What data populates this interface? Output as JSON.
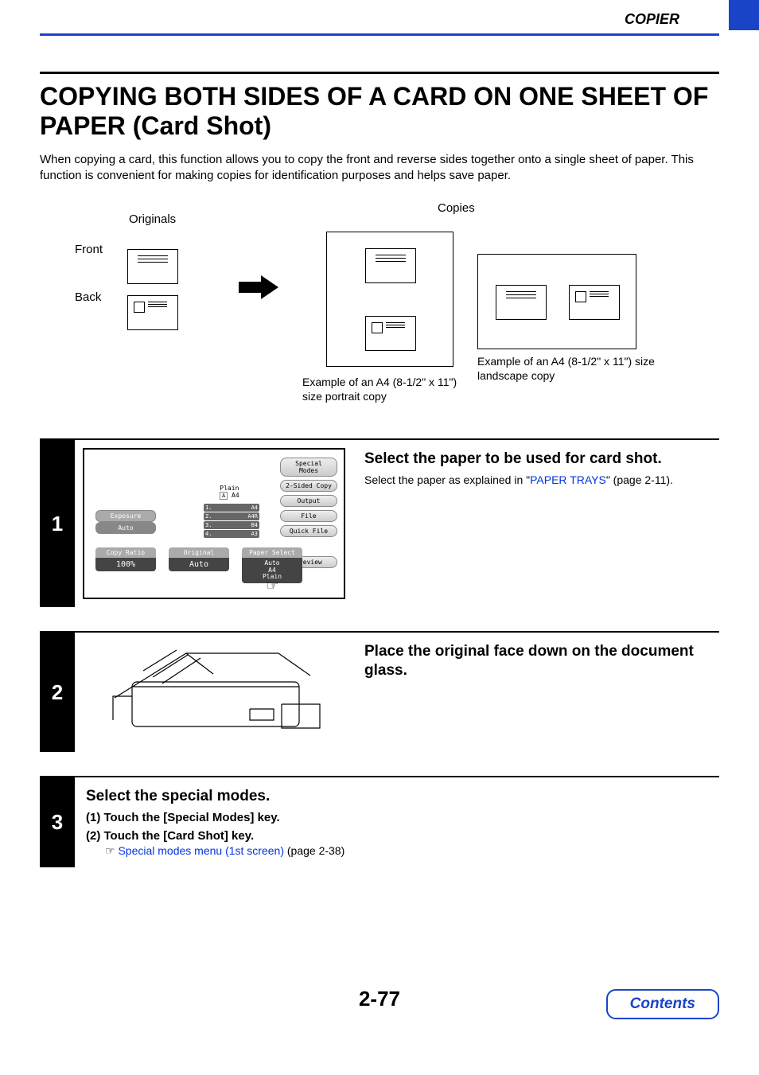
{
  "header": {
    "section": "COPIER"
  },
  "title": "COPYING BOTH SIDES OF A CARD ON ONE SHEET OF PAPER (Card Shot)",
  "intro": "When copying a card, this function allows you to copy the front and reverse sides together onto a single sheet of paper. This function is convenient for making copies for identification purposes and helps save paper.",
  "diagram": {
    "originals_label": "Originals",
    "front_label": "Front",
    "back_label": "Back",
    "copies_label": "Copies",
    "portrait_caption": "Example of an A4 (8-1/2\" x 11\") size portrait copy",
    "landscape_caption": "Example of an A4 (8-1/2\" x 11\") size landscape copy"
  },
  "ui_panel": {
    "special_modes": "Special Modes",
    "two_sided": "2-Sided Copy",
    "output": "Output",
    "file": "File",
    "quick_file": "Quick File",
    "preview": "Preview",
    "exposure_label": "Exposure",
    "exposure_value": "Auto",
    "copy_ratio_label": "Copy Ratio",
    "copy_ratio_value": "100%",
    "original_label": "Original",
    "original_value": "Auto",
    "paper_select_label": "Paper Select",
    "paper_select_value1": "Auto",
    "paper_select_value2": "A4",
    "paper_select_value3": "Plain",
    "plain_label": "Plain",
    "plain_size": "A4",
    "trays": [
      {
        "n": "1.",
        "s": "A4"
      },
      {
        "n": "2.",
        "s": "A4R"
      },
      {
        "n": "3.",
        "s": "B4"
      },
      {
        "n": "4.",
        "s": "A3"
      }
    ]
  },
  "steps": {
    "s1": {
      "num": "1",
      "title": "Select the paper to be used for card shot.",
      "text_pre": "Select the paper as explained in \"",
      "link": "PAPER TRAYS",
      "text_post": "\" (page 2-11)."
    },
    "s2": {
      "num": "2",
      "title": "Place the original face down on the document glass."
    },
    "s3": {
      "num": "3",
      "title": "Select the special modes.",
      "item1": "(1)  Touch the [Special Modes] key.",
      "item2": "(2)  Touch the [Card Shot] key.",
      "note_link": "Special modes menu (1st screen)",
      "note_tail": " (page 2-38)"
    }
  },
  "footer": {
    "page_num": "2-77",
    "contents": "Contents"
  }
}
